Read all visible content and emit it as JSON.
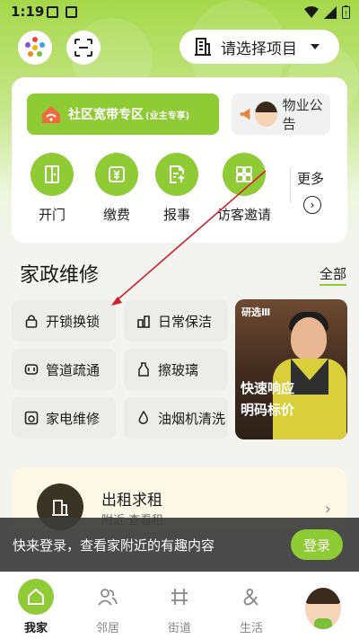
{
  "status_bar": {
    "time": "1:19"
  },
  "header": {
    "project_selector": "请选择项目"
  },
  "banner": {
    "broadband": "社区宽带专区",
    "broadband_note": "(业主专享)",
    "notice": "物业公告"
  },
  "quick_actions": [
    {
      "label": "开门",
      "icon": "door-icon"
    },
    {
      "label": "缴费",
      "icon": "payment-icon"
    },
    {
      "label": "报事",
      "icon": "report-icon"
    },
    {
      "label": "访客邀请",
      "icon": "qr-grid-icon"
    }
  ],
  "more": {
    "label": "更多"
  },
  "section": {
    "title": "家政维修",
    "all": "全部"
  },
  "services": [
    {
      "label": "开锁换锁",
      "icon": "lock-icon"
    },
    {
      "label": "日常保洁",
      "icon": "cleaning-icon"
    },
    {
      "label": "管道疏通",
      "icon": "pipe-icon"
    },
    {
      "label": "擦玻璃",
      "icon": "bottle-icon"
    },
    {
      "label": "家电维修",
      "icon": "appliance-icon"
    },
    {
      "label": "油烟机清洗",
      "icon": "drop-icon"
    }
  ],
  "promo": {
    "tag": "研选Ⅲ",
    "line1": "快速响应",
    "line2": "明码标价"
  },
  "rental": {
    "title": "出租求租",
    "subtitle": "附近 查看租"
  },
  "toast": {
    "message": "快来登录，查看家附近的有趣内容",
    "login": "登录"
  },
  "nav": [
    {
      "label": "我家",
      "icon": "home-icon",
      "active": true
    },
    {
      "label": "邻居",
      "icon": "people-icon"
    },
    {
      "label": "街道",
      "icon": "street-icon"
    },
    {
      "label": "生活",
      "icon": "ampersand-icon"
    }
  ],
  "colors": {
    "brand": "#8ecb35",
    "brand_light": "#a6d84a",
    "toast_bg": "#3c3c3c"
  }
}
